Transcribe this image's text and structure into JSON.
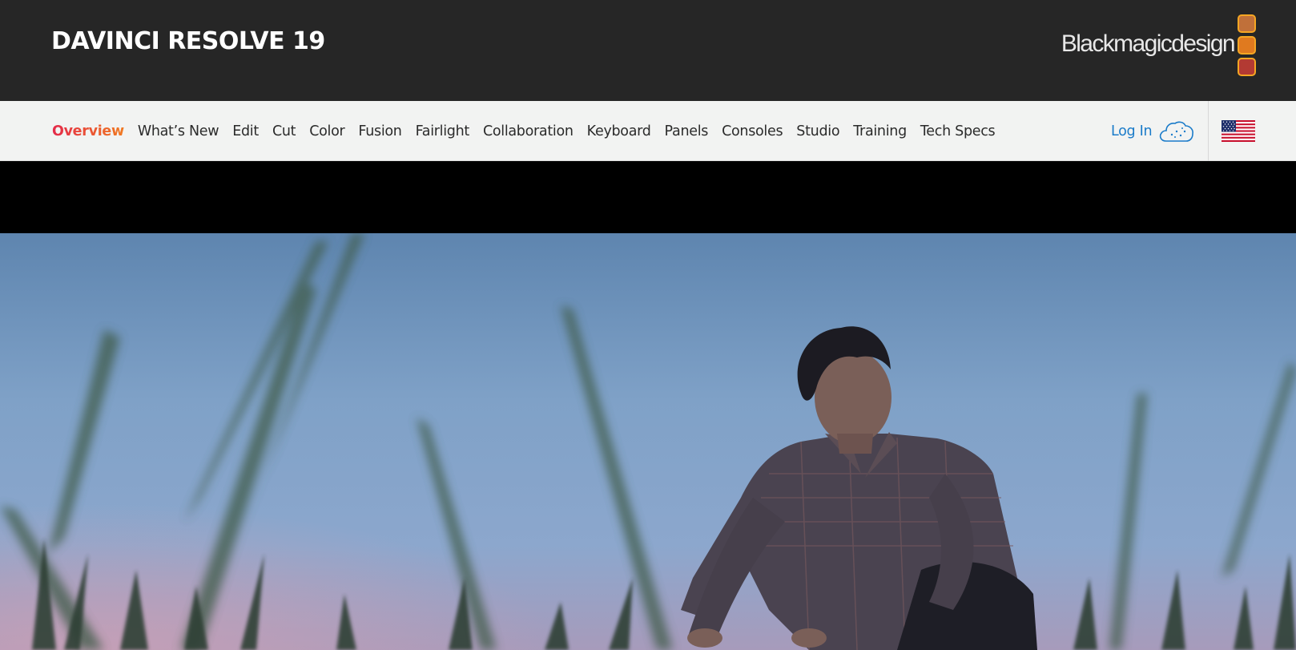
{
  "header": {
    "product_title": "DAVINCI RESOLVE 19",
    "brand": {
      "wordmark": "Blackmagicdesign",
      "square_colors": [
        "#c0703a",
        "#e07a1f",
        "#b33a33"
      ],
      "square_border_color": "#f5a623"
    }
  },
  "nav": {
    "items": [
      {
        "label": "Overview",
        "active": true
      },
      {
        "label": "What’s New",
        "active": false
      },
      {
        "label": "Edit",
        "active": false
      },
      {
        "label": "Cut",
        "active": false
      },
      {
        "label": "Color",
        "active": false
      },
      {
        "label": "Fusion",
        "active": false
      },
      {
        "label": "Fairlight",
        "active": false
      },
      {
        "label": "Collaboration",
        "active": false
      },
      {
        "label": "Keyboard",
        "active": false
      },
      {
        "label": "Panels",
        "active": false
      },
      {
        "label": "Consoles",
        "active": false
      },
      {
        "label": "Studio",
        "active": false
      },
      {
        "label": "Training",
        "active": false
      },
      {
        "label": "Tech Specs",
        "active": false
      }
    ],
    "login_label": "Log In",
    "login_icon": "cloud-icon",
    "region_icon": "us-flag-icon"
  },
  "hero": {
    "image": "man-crouching-in-tall-grass-at-dusk"
  },
  "colors": {
    "header_bg": "#262626",
    "nav_bg": "#f2f3f2",
    "nav_active_gradient": [
      "#e42a4a",
      "#f07a22"
    ],
    "login_blue": "#1a7bc9"
  }
}
